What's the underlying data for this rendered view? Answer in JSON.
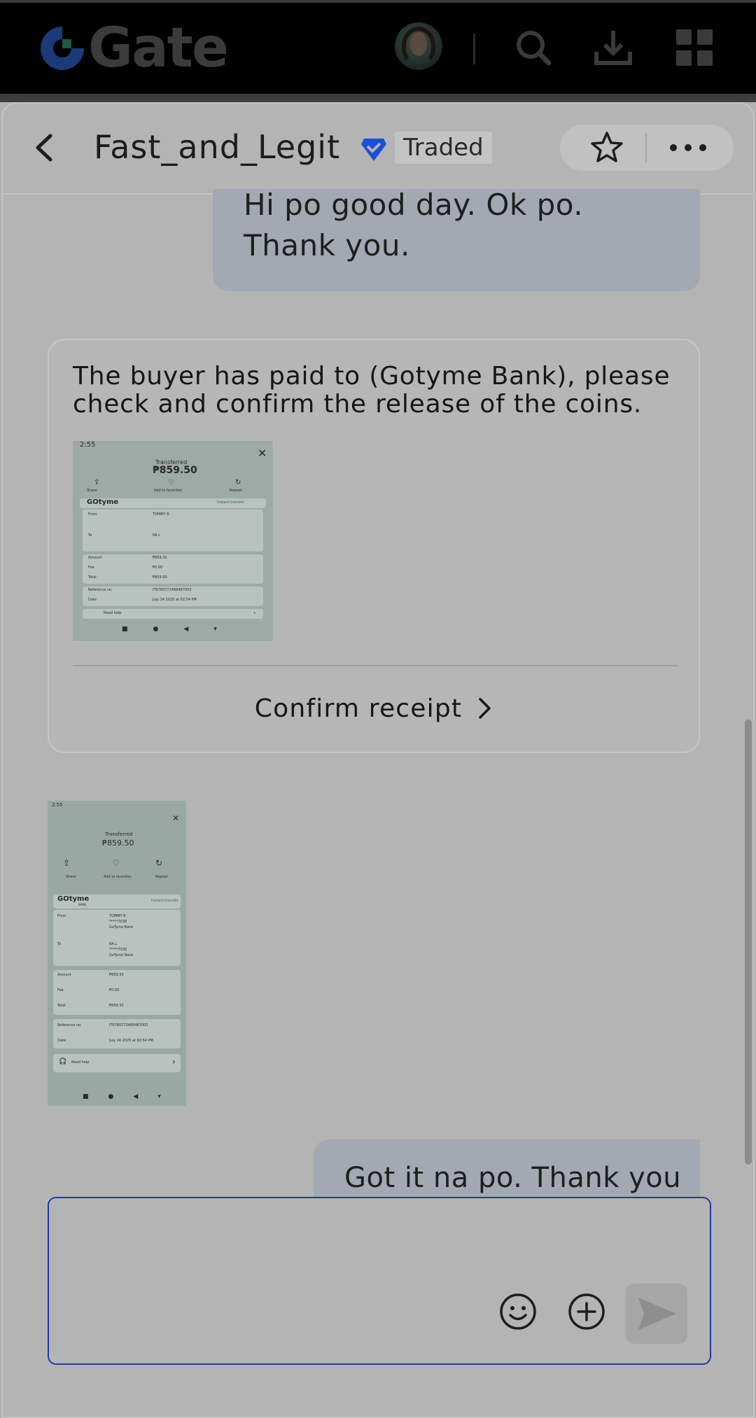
{
  "topbar": {
    "brand": "Gate",
    "icons": [
      "gate-logo-icon",
      "avatar",
      "search-icon",
      "download-icon",
      "apps-grid-icon"
    ]
  },
  "header": {
    "title": "Fast_and_Legit",
    "badge": "Traded",
    "icons": [
      "back-arrow-icon",
      "verified-icon",
      "star-icon",
      "more-dots-icon"
    ]
  },
  "messages": {
    "first_reply": "Hi po good day. Ok po. Thank you.",
    "system_notice": "The buyer has paid to (Gotyme Bank), please check and confirm the release of the coins.",
    "confirm_label": "Confirm receipt",
    "last_reply": "Got it na po. Thank you"
  },
  "receipt": {
    "time": "2:55",
    "status": "Transferred",
    "amount": "₱859.50",
    "actions": [
      "Share",
      "Add to favorites",
      "Repeat"
    ],
    "bank_logo": "GOtyme",
    "bank_sub": "BANK",
    "transfer_type": "Instant transfer",
    "from_label": "From",
    "from_name": "TOMMY R",
    "from_acct": "*****7038",
    "from_bank": "GoTyme Bank",
    "to_label": "To",
    "to_name": "RA L",
    "to_acct": "*****7335",
    "to_bank": "GoTyme Bank",
    "amount_label": "Amount",
    "amount_value": "₱859.50",
    "fee_label": "Fee",
    "fee_value": "₱0.00",
    "total_label": "Total",
    "total_value": "₱859.50",
    "ref_label": "Reference no.",
    "ref_value": "IT6760772466487003",
    "date_label": "Date",
    "date_value": "July 24 2025 at 02:54 PM",
    "help_label": "Need help"
  },
  "composer": {
    "placeholder": "",
    "icons": [
      "emoji-icon",
      "add-circle-icon",
      "send-icon"
    ]
  },
  "colors": {
    "overlay_grey": "#b2b2b2",
    "my_bubble": "#a4a8b2",
    "input_border": "#2338a6",
    "verified_blue": "#1a4fd6",
    "receipt_bg": "#9daaa6"
  }
}
